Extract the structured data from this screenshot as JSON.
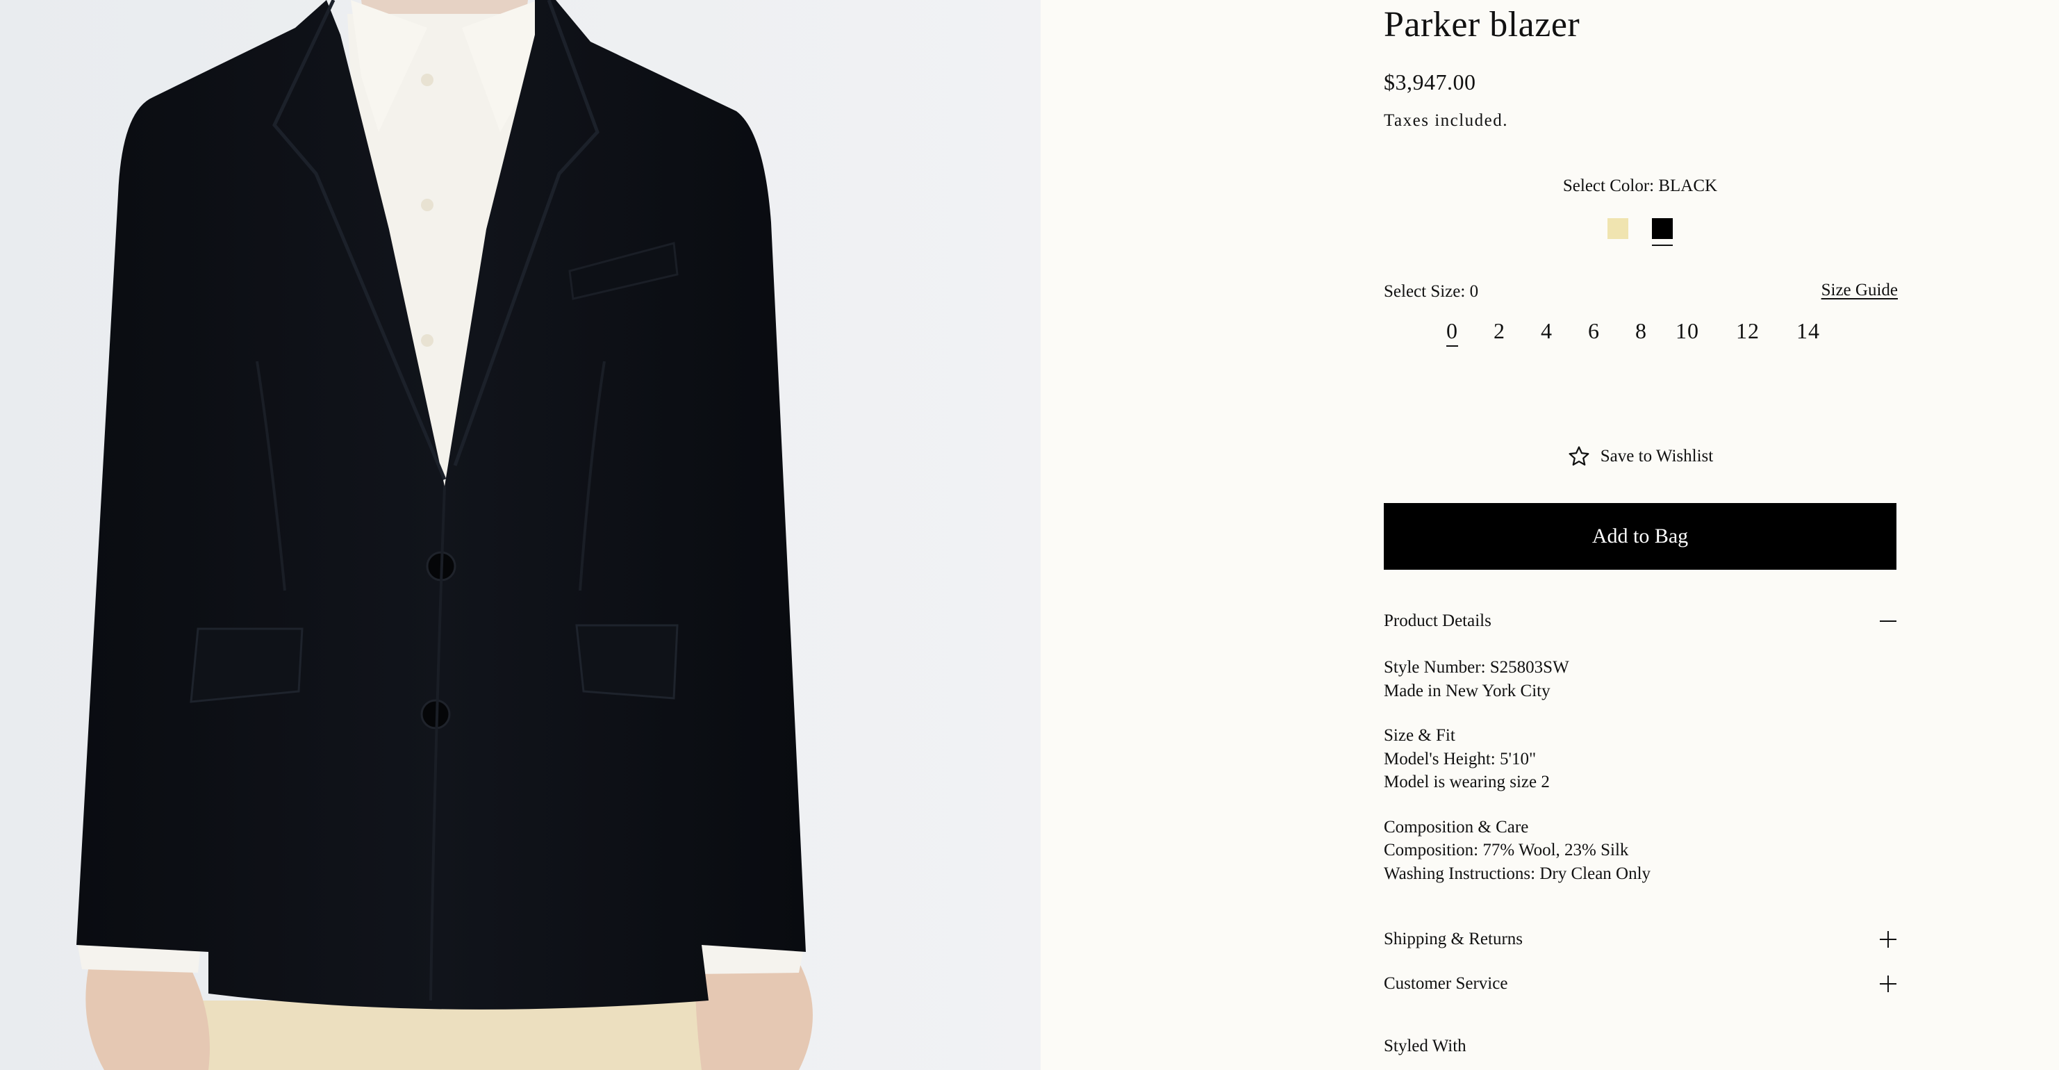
{
  "product": {
    "title": "Parker blazer",
    "price": "$3,947.00",
    "taxes_note": "Taxes included."
  },
  "color": {
    "label": "Select Color: BLACK",
    "swatches": [
      {
        "name": "cream",
        "hex": "#f0e4b0",
        "selected": false
      },
      {
        "name": "black",
        "hex": "#000000",
        "selected": true
      }
    ]
  },
  "size": {
    "label": "Select Size: 0",
    "guide_label": "Size Guide",
    "options": [
      "0",
      "2",
      "4",
      "6",
      "8",
      "10",
      "12",
      "14"
    ],
    "selected": "0"
  },
  "wishlist_label": "Save to Wishlist",
  "add_to_bag_label": "Add to Bag",
  "accordion": {
    "product_details": {
      "title": "Product Details",
      "expanded": true,
      "lines": {
        "style_number": "Style Number: S25803SW",
        "origin": "Made in New York City",
        "size_fit_title": "Size & Fit",
        "model_height": "Model's Height: 5'10\"",
        "model_size": "Model is wearing size 2",
        "composition_title": "Composition & Care",
        "composition": "Composition: 77% Wool, 23% Silk",
        "washing": "Washing Instructions: Dry Clean Only"
      }
    },
    "shipping_returns": {
      "title": "Shipping & Returns",
      "expanded": false
    },
    "customer_service": {
      "title": "Customer Service",
      "expanded": false
    }
  },
  "styled_with_title": "Styled With",
  "colors": {
    "page_bg": "#fcfbf7",
    "image_bg": "#eef0f2",
    "button_bg": "#000000",
    "blazer": "#0b0d12"
  }
}
